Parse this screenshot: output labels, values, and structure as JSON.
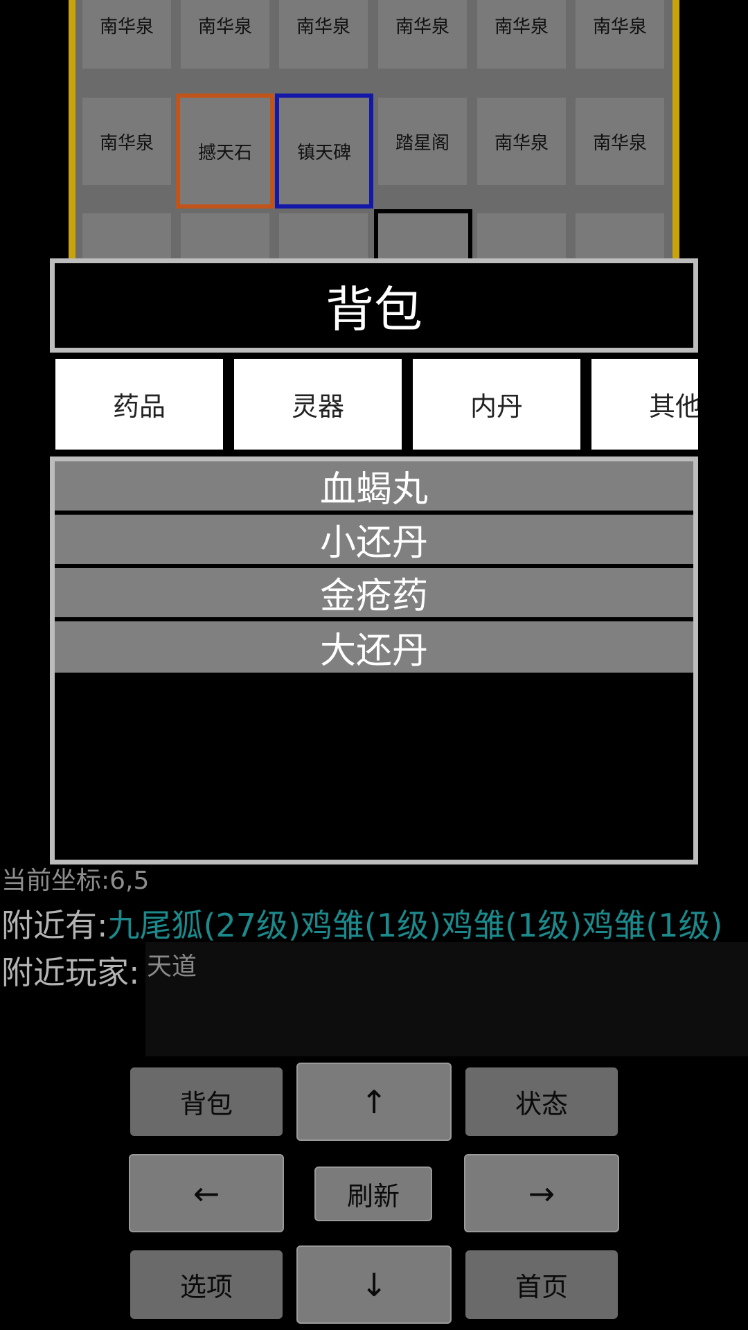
{
  "map": {
    "row1": [
      "南华泉",
      "南华泉",
      "南华泉",
      "南华泉",
      "南华泉",
      "南华泉"
    ],
    "row2": [
      "南华泉",
      "撼天石",
      "镇天碑",
      "踏星阁",
      "南华泉",
      "南华泉"
    ]
  },
  "dialog": {
    "title": "背包",
    "tabs": [
      "药品",
      "灵器",
      "内丹",
      "其他"
    ],
    "items": [
      "血蝎丸",
      "小还丹",
      "金疮药",
      "大还丹"
    ]
  },
  "status": {
    "coord": "当前坐标:6,5",
    "nearby_label": "附近有:",
    "nearby_value": "九尾狐(27级)鸡雏(1级)鸡雏(1级)鸡雏(1级)",
    "players_label": "附近玩家:",
    "players_value": "天道"
  },
  "controls": {
    "backpack": "背包",
    "up": "↑",
    "status": "状态",
    "left": "←",
    "refresh": "刷新",
    "right": "→",
    "options": "选项",
    "down": "↓",
    "home": "首页"
  }
}
